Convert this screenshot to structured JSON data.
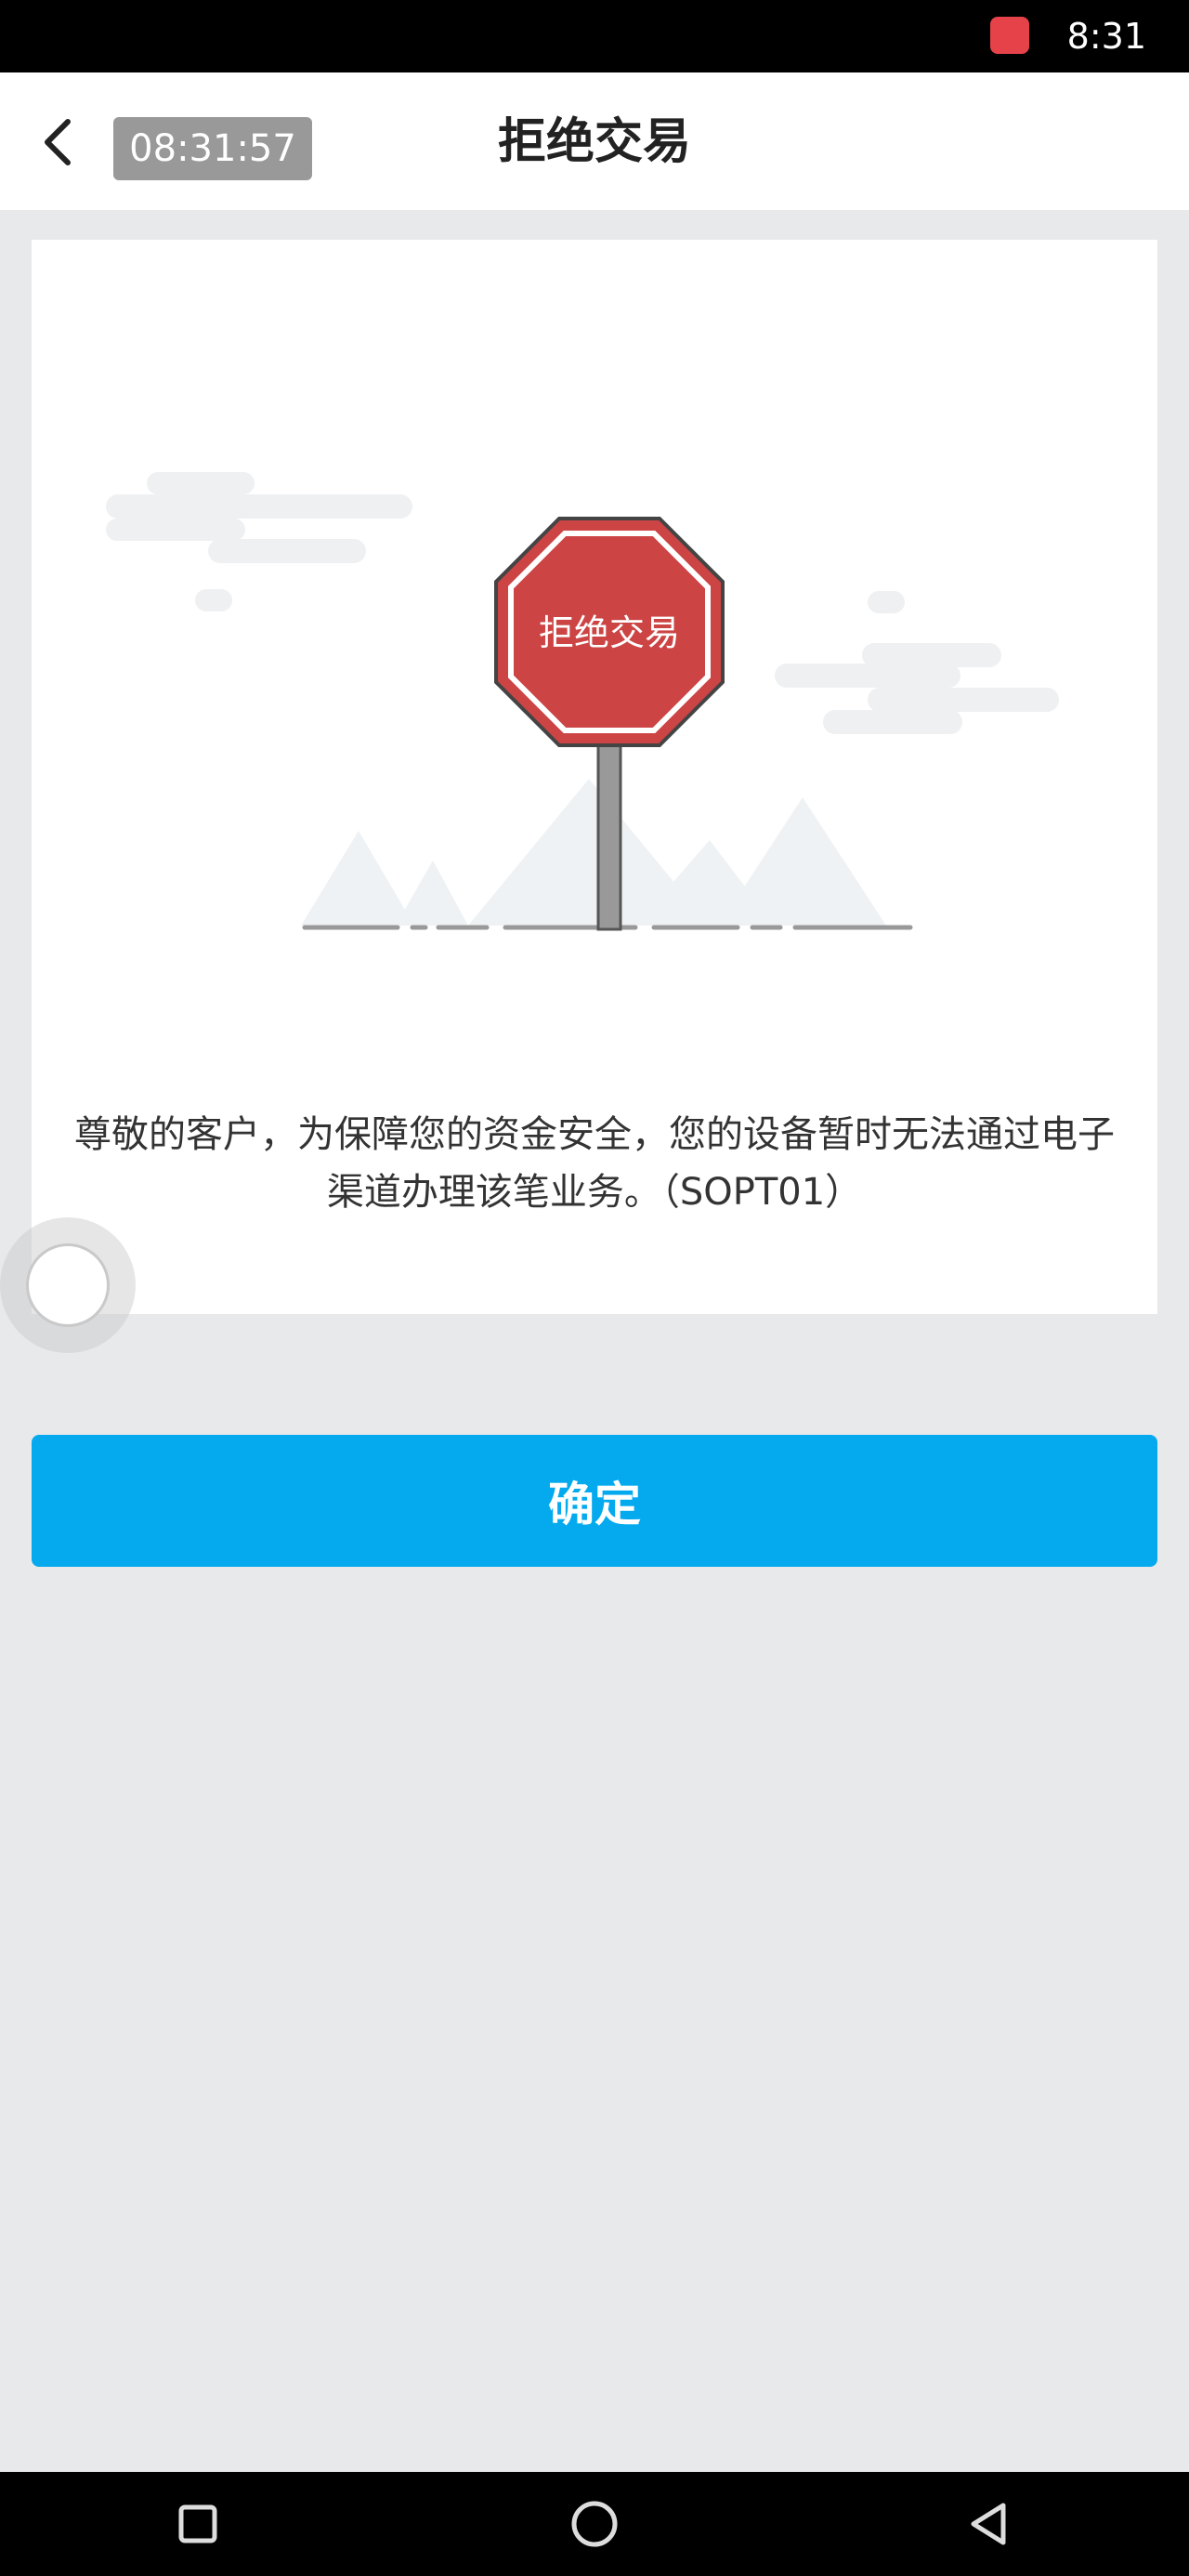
{
  "status_bar": {
    "time": "8:31",
    "app_icon": "huawei-store-icon"
  },
  "header": {
    "back_icon": "chevron-left-icon",
    "timer": "08:31:57",
    "title": "拒绝交易"
  },
  "card": {
    "sign_text": "拒绝交易",
    "message": "尊敬的客户，为保障您的资金安全，您的设备暂时无法通过电子渠道办理该笔业务。（SOPT01）"
  },
  "actions": {
    "confirm_label": "确定"
  },
  "nav_bar": {
    "recent_icon": "square-icon",
    "home_icon": "circle-icon",
    "back_icon": "triangle-back-icon"
  },
  "colors": {
    "primary": "#05aaee",
    "sign_red": "#cc4444",
    "background": "#e8e9eb"
  }
}
